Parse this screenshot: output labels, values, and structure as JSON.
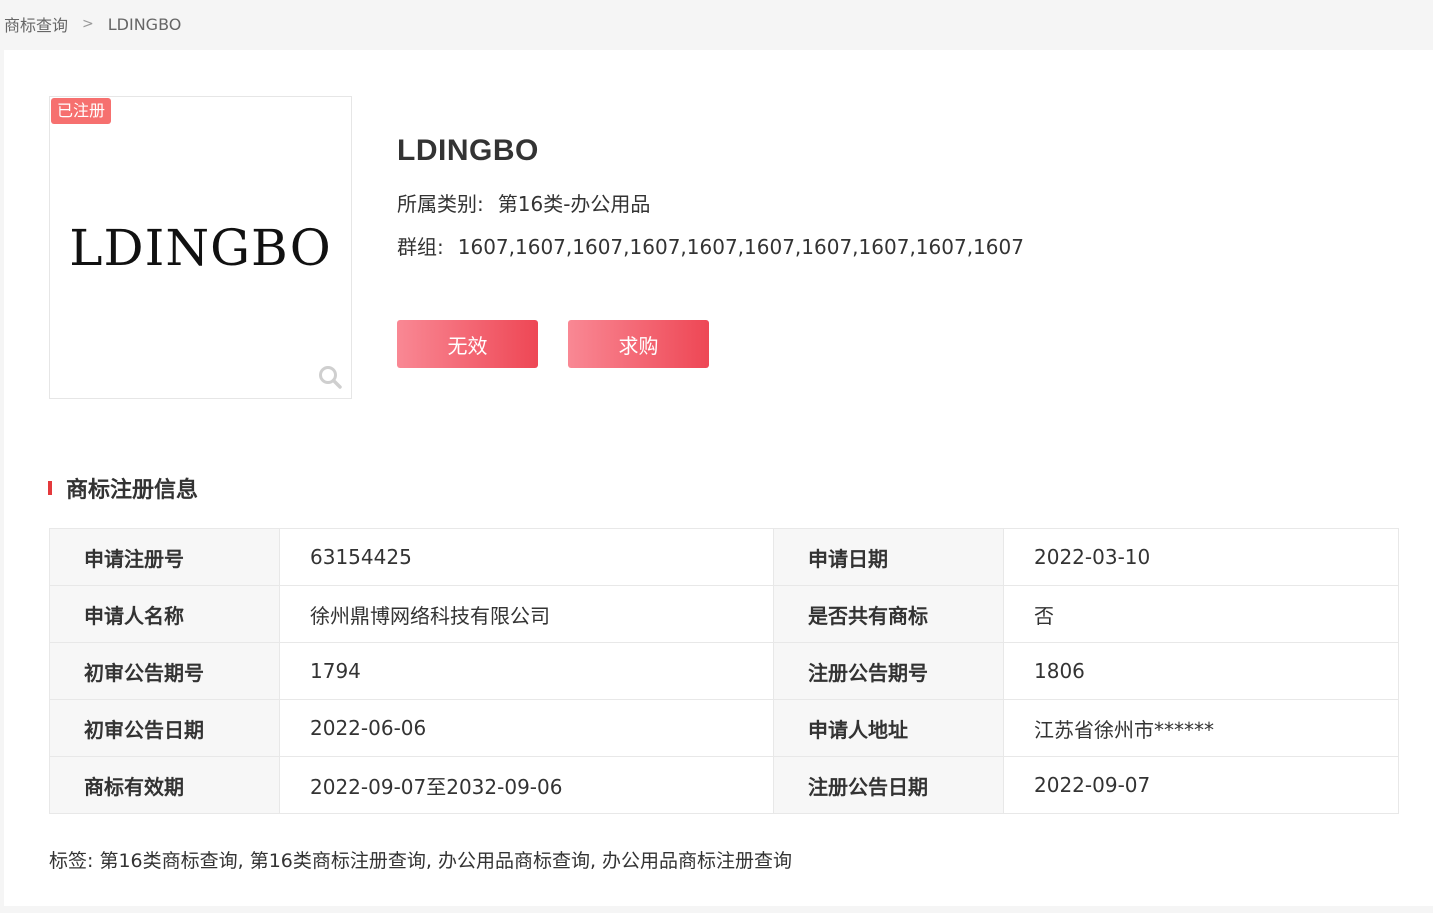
{
  "breadcrumb": {
    "root": "商标查询",
    "separator": ">",
    "current": "LDINGBO"
  },
  "trademark": {
    "status": "已注册",
    "logo_text": "LDINGBO",
    "name": "LDINGBO",
    "category_label": "所属类别:",
    "category_value": "第16类-办公用品",
    "group_label": "群组:",
    "group_value": "1607,1607,1607,1607,1607,1607,1607,1607,1607,1607"
  },
  "buttons": {
    "invalid": "无效",
    "buy": "求购"
  },
  "section": {
    "title": "商标注册信息"
  },
  "table": {
    "rows": [
      {
        "l1": "申请注册号",
        "v1": "63154425",
        "l2": "申请日期",
        "v2": "2022-03-10"
      },
      {
        "l1": "申请人名称",
        "v1": "徐州鼎博网络科技有限公司",
        "l2": "是否共有商标",
        "v2": "否"
      },
      {
        "l1": "初审公告期号",
        "v1": "1794",
        "l2": "注册公告期号",
        "v2": "1806"
      },
      {
        "l1": "初审公告日期",
        "v1": "2022-06-06",
        "l2": "申请人地址",
        "v2": "江苏省徐州市******"
      },
      {
        "l1": "商标有效期",
        "v1": "2022-09-07至2032-09-06",
        "l2": "注册公告日期",
        "v2": "2022-09-07"
      }
    ]
  },
  "tags": "标签: 第16类商标查询, 第16类商标注册查询, 办公用品商标查询, 办公用品商标注册查询",
  "colors": {
    "accent": "#e4393c",
    "badge": "#f6706f",
    "button_start": "#f98894",
    "button_end": "#ee4755"
  }
}
